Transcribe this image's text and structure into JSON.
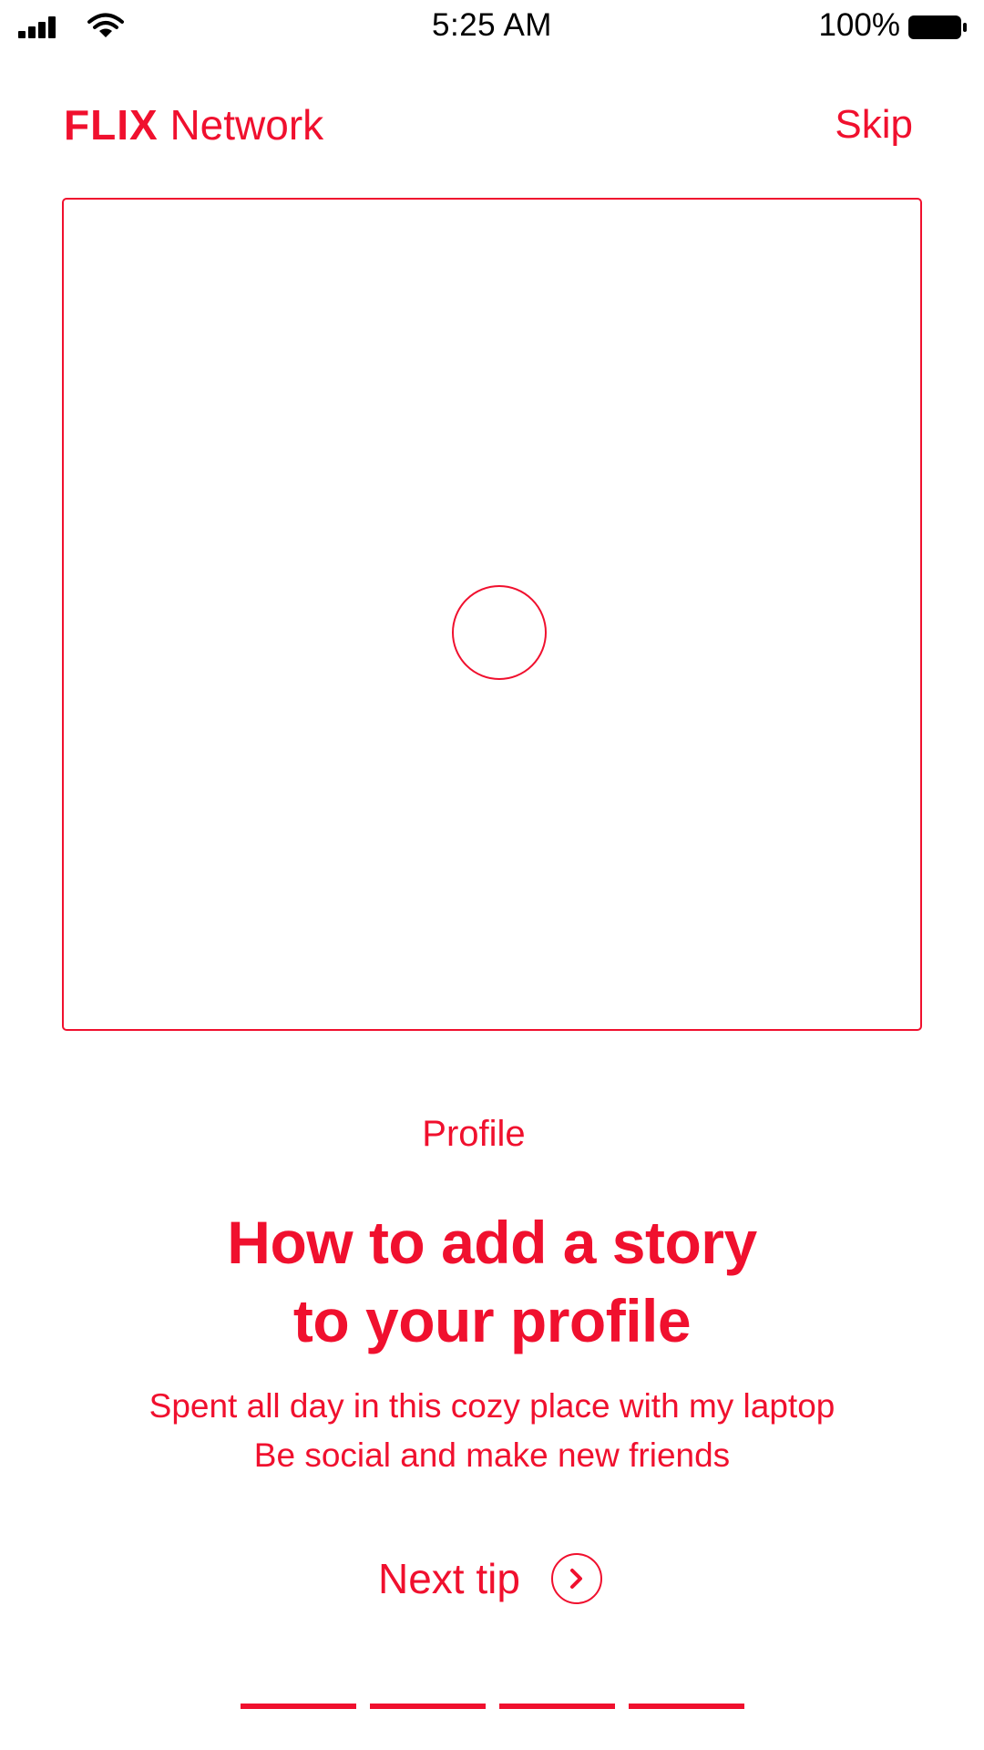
{
  "status_bar": {
    "time": "5:25 AM",
    "battery_percent": "100%",
    "signal_icon": "cellular-signal-icon",
    "wifi_icon": "wifi-icon",
    "battery_icon": "battery-icon"
  },
  "header": {
    "brand_bold": "FLIX",
    "brand_light": "Network",
    "skip_label": "Skip"
  },
  "media": {
    "play_icon": "circle-icon"
  },
  "content": {
    "category": "Profile",
    "title_line1": "How to add a story",
    "title_line2": "to your profile",
    "desc_line1": "Spent all day in this cozy place with my laptop",
    "desc_line2": "Be social and make new friends"
  },
  "next_tip": {
    "label": "Next tip",
    "icon": "chevron-right-circle-icon"
  },
  "pagination": {
    "count": 4
  },
  "colors": {
    "accent": "#f0102e",
    "background": "#ffffff",
    "status_text": "#000000"
  }
}
